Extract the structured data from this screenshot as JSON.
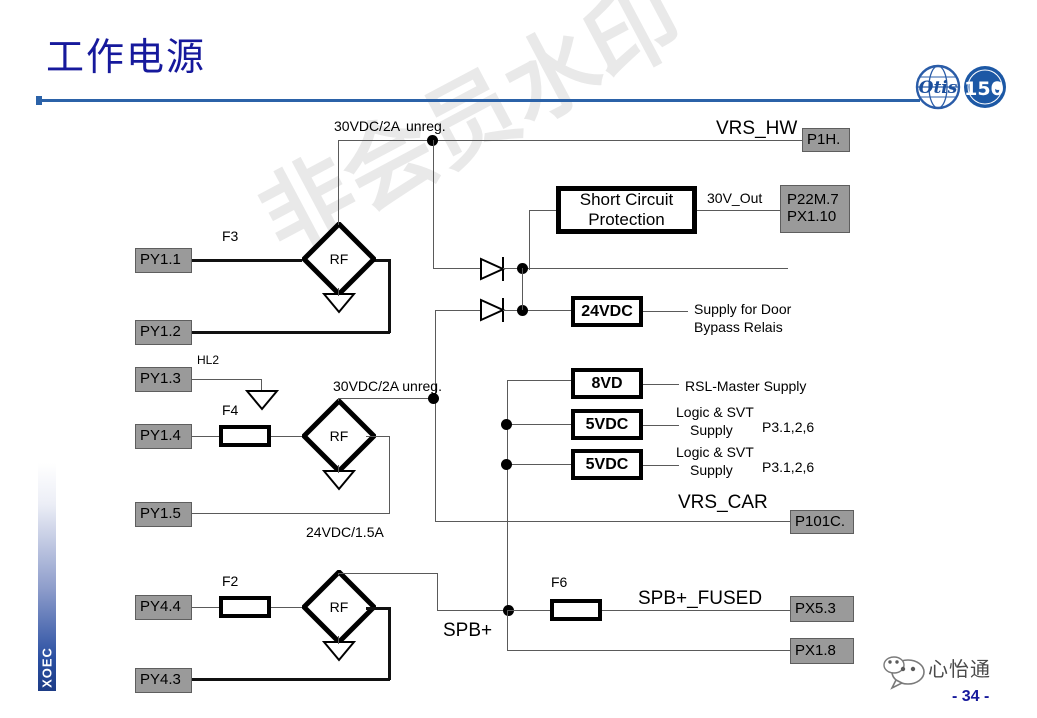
{
  "slide": {
    "title": "工作电源",
    "page_number": "- 34 -",
    "side_tab": "XOEC",
    "watermark": "非会员水印",
    "footer_brand": "心怡通",
    "logos": {
      "otis": "otis-globe-logo",
      "anniversary": "otis-150-anniversary-logo",
      "footer": "wechat-bubble-icon"
    }
  },
  "diagram": {
    "input_pins": [
      {
        "id": "py11",
        "label": "PY1.1"
      },
      {
        "id": "py12",
        "label": "PY1.2"
      },
      {
        "id": "py13",
        "label": "PY1.3"
      },
      {
        "id": "py14",
        "label": "PY1.4"
      },
      {
        "id": "py15",
        "label": "PY1.5"
      },
      {
        "id": "py44",
        "label": "PY4.4"
      },
      {
        "id": "py43",
        "label": "PY4.3"
      }
    ],
    "output_pins": [
      {
        "id": "p1h",
        "label": "P1H."
      },
      {
        "id": "p22m7",
        "label": "P22M.7"
      },
      {
        "id": "px110",
        "label": "PX1.10"
      },
      {
        "id": "p101c",
        "label": "P101C."
      },
      {
        "id": "px53",
        "label": "PX5.3"
      },
      {
        "id": "px18",
        "label": "PX1.8"
      }
    ],
    "rectifiers": [
      {
        "id": "rf1",
        "label": "RF"
      },
      {
        "id": "rf2",
        "label": "RF"
      },
      {
        "id": "rf3",
        "label": "RF"
      }
    ],
    "fuses": [
      {
        "id": "f3",
        "label": "F3"
      },
      {
        "id": "f4",
        "label": "F4"
      },
      {
        "id": "f2",
        "label": "F2"
      },
      {
        "id": "f6",
        "label": "F6"
      }
    ],
    "modules": [
      {
        "id": "scp",
        "line1": "Short Circuit",
        "line2": "Protection"
      },
      {
        "id": "v24",
        "label": "24VDC"
      },
      {
        "id": "v8",
        "label": "8VD"
      },
      {
        "id": "v5a",
        "label": "5VDC"
      },
      {
        "id": "v5b",
        "label": "5VDC"
      }
    ],
    "annotations": {
      "supply_top": "30VDC/2A",
      "unreg_top": "unreg.",
      "supply_mid": "30VDC/2A unreg.",
      "supply_24v": "24VDC/1.5A",
      "hl2": "HL2",
      "vrs_hw": "VRS_HW",
      "vrs_car": "VRS_CAR",
      "v30_out": "30V_Out",
      "spb_plus": "SPB+",
      "spb_fused": "SPB+_FUSED",
      "door_bypass_1": "Supply for Door",
      "door_bypass_2": "Bypass Relais",
      "rsl_master": "RSL-Master Supply",
      "logic_svt_1a": "Logic & SVT",
      "logic_svt_1b": "Supply",
      "logic_svt_port_1": "P3.1,2,6",
      "logic_svt_2a": "Logic & SVT",
      "logic_svt_2b": "Supply",
      "logic_svt_port_2": "P3.1,2,6"
    }
  },
  "colors": {
    "title": "#16199c",
    "rule": "#2b62a8",
    "pin_fill": "#9a9a9a",
    "wire": "#5a5a5a",
    "watermark": "#e9e9e9"
  }
}
